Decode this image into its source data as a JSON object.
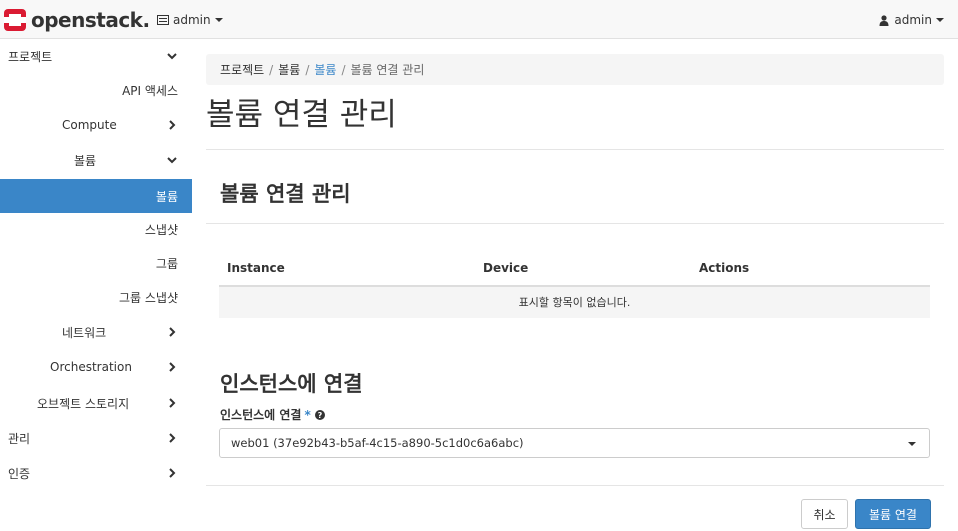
{
  "topbar": {
    "brand": "openstack.",
    "project_switcher": "admin",
    "user_menu": "admin"
  },
  "sidebar": {
    "items": [
      {
        "label": "프로젝트"
      },
      {
        "label": "API 액세스"
      },
      {
        "label": "Compute"
      },
      {
        "label": "볼륨"
      },
      {
        "label": "볼륨"
      },
      {
        "label": "스냅샷"
      },
      {
        "label": "그룹"
      },
      {
        "label": "그룹 스냅샷"
      },
      {
        "label": "네트워크"
      },
      {
        "label": "Orchestration"
      },
      {
        "label": "오브젝트 스토리지"
      },
      {
        "label": "관리"
      },
      {
        "label": "인증"
      }
    ]
  },
  "breadcrumb": {
    "items": [
      "프로젝트",
      "볼륨",
      "볼륨",
      "볼륨 연결 관리"
    ],
    "separator": "/"
  },
  "page_title": "볼륨 연결 관리",
  "section_title": "볼륨 연결 관리",
  "table": {
    "columns": [
      "Instance",
      "Device",
      "Actions"
    ],
    "empty_message": "표시할 항목이 없습니다."
  },
  "attach": {
    "title": "인스턴스에 연결",
    "field_label": "인스턴스에 연결",
    "required_mark": "*",
    "selected_value": "web01 (37e92b43-b5af-4c15-a890-5c1d0c6a6abc)"
  },
  "buttons": {
    "cancel": "취소",
    "submit": "볼륨 연결"
  },
  "colors": {
    "accent": "#3a86c8",
    "brand_red": "#da1a32"
  }
}
